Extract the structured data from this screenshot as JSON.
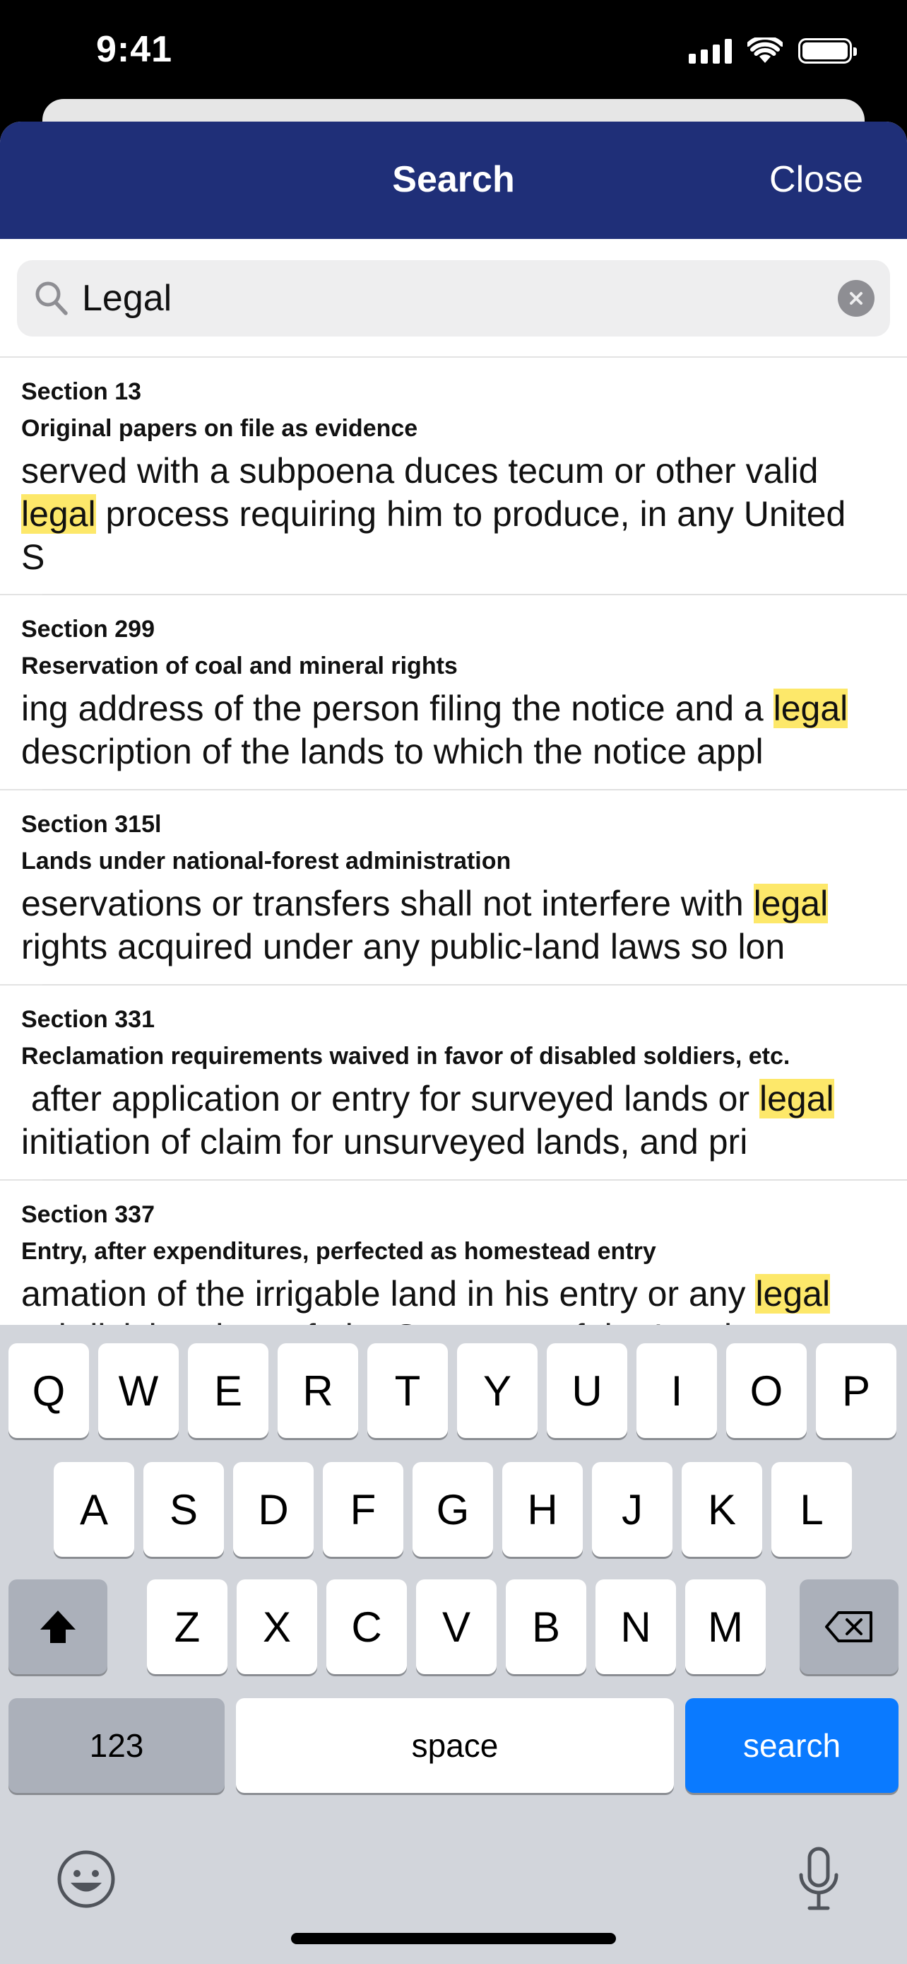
{
  "status": {
    "time": "9:41"
  },
  "nav": {
    "title": "Search",
    "close_label": "Close"
  },
  "search": {
    "value": "Legal"
  },
  "results": [
    {
      "section": "Section 13",
      "title": "Original papers on file as evidence",
      "lines": [
        [
          {
            "t": "served with a subpoena duces tecum or other valid",
            "h": false
          }
        ],
        [
          {
            "t": "legal",
            "h": true
          },
          {
            "t": " process requiring him to produce, in any United",
            "h": false
          }
        ],
        [
          {
            "t": "S",
            "h": false
          }
        ]
      ]
    },
    {
      "section": "Section 299",
      "title": "Reservation of coal and mineral rights",
      "lines": [
        [
          {
            "t": "ing address of the person filing the notice and a ",
            "h": false
          },
          {
            "t": "legal",
            "h": true
          }
        ],
        [
          {
            "t": "description of the lands to which the notice appl",
            "h": false
          }
        ]
      ]
    },
    {
      "section": "Section 315l",
      "title": "Lands under national-forest administration",
      "lines": [
        [
          {
            "t": "eservations or transfers shall not interfere with ",
            "h": false
          },
          {
            "t": "legal",
            "h": true
          }
        ],
        [
          {
            "t": "rights acquired under any public-land laws so lon",
            "h": false
          }
        ]
      ]
    },
    {
      "section": "Section 331",
      "title": "Reclamation requirements waived in favor of disabled soldiers, etc.",
      "lines": [
        [
          {
            "t": " after application or entry for surveyed lands or ",
            "h": false
          },
          {
            "t": "legal",
            "h": true
          }
        ],
        [
          {
            "t": "initiation of claim for unsurveyed lands, and pri",
            "h": false
          }
        ]
      ]
    },
    {
      "section": "Section 337",
      "title": "Entry, after expenditures, perfected as homestead entry",
      "lines": [
        [
          {
            "t": "amation of the irrigable land in his entry or any ",
            "h": false
          },
          {
            "t": "legal",
            "h": true
          }
        ],
        [
          {
            "t": "subdivision thereof, the Secretary of the Interior",
            "h": false
          }
        ]
      ]
    }
  ],
  "keyboard": {
    "row1": [
      "Q",
      "W",
      "E",
      "R",
      "T",
      "Y",
      "U",
      "I",
      "O",
      "P"
    ],
    "row2": [
      "A",
      "S",
      "D",
      "F",
      "G",
      "H",
      "J",
      "K",
      "L"
    ],
    "row3": [
      "Z",
      "X",
      "C",
      "V",
      "B",
      "N",
      "M"
    ],
    "numbers_label": "123",
    "space_label": "space",
    "search_label": "search"
  },
  "icons": {
    "signal": "cellular-signal-icon",
    "wifi": "wifi-icon",
    "battery": "battery-icon",
    "search": "magnifier-icon",
    "clear": "clear-circle-icon",
    "shift": "shift-arrow-icon",
    "delete": "backspace-icon",
    "emoji": "emoji-face-icon",
    "mic": "microphone-icon"
  },
  "colors": {
    "nav_bg": "#1f2f78",
    "highlight": "#fde86a",
    "search_key": "#0a7aff"
  }
}
